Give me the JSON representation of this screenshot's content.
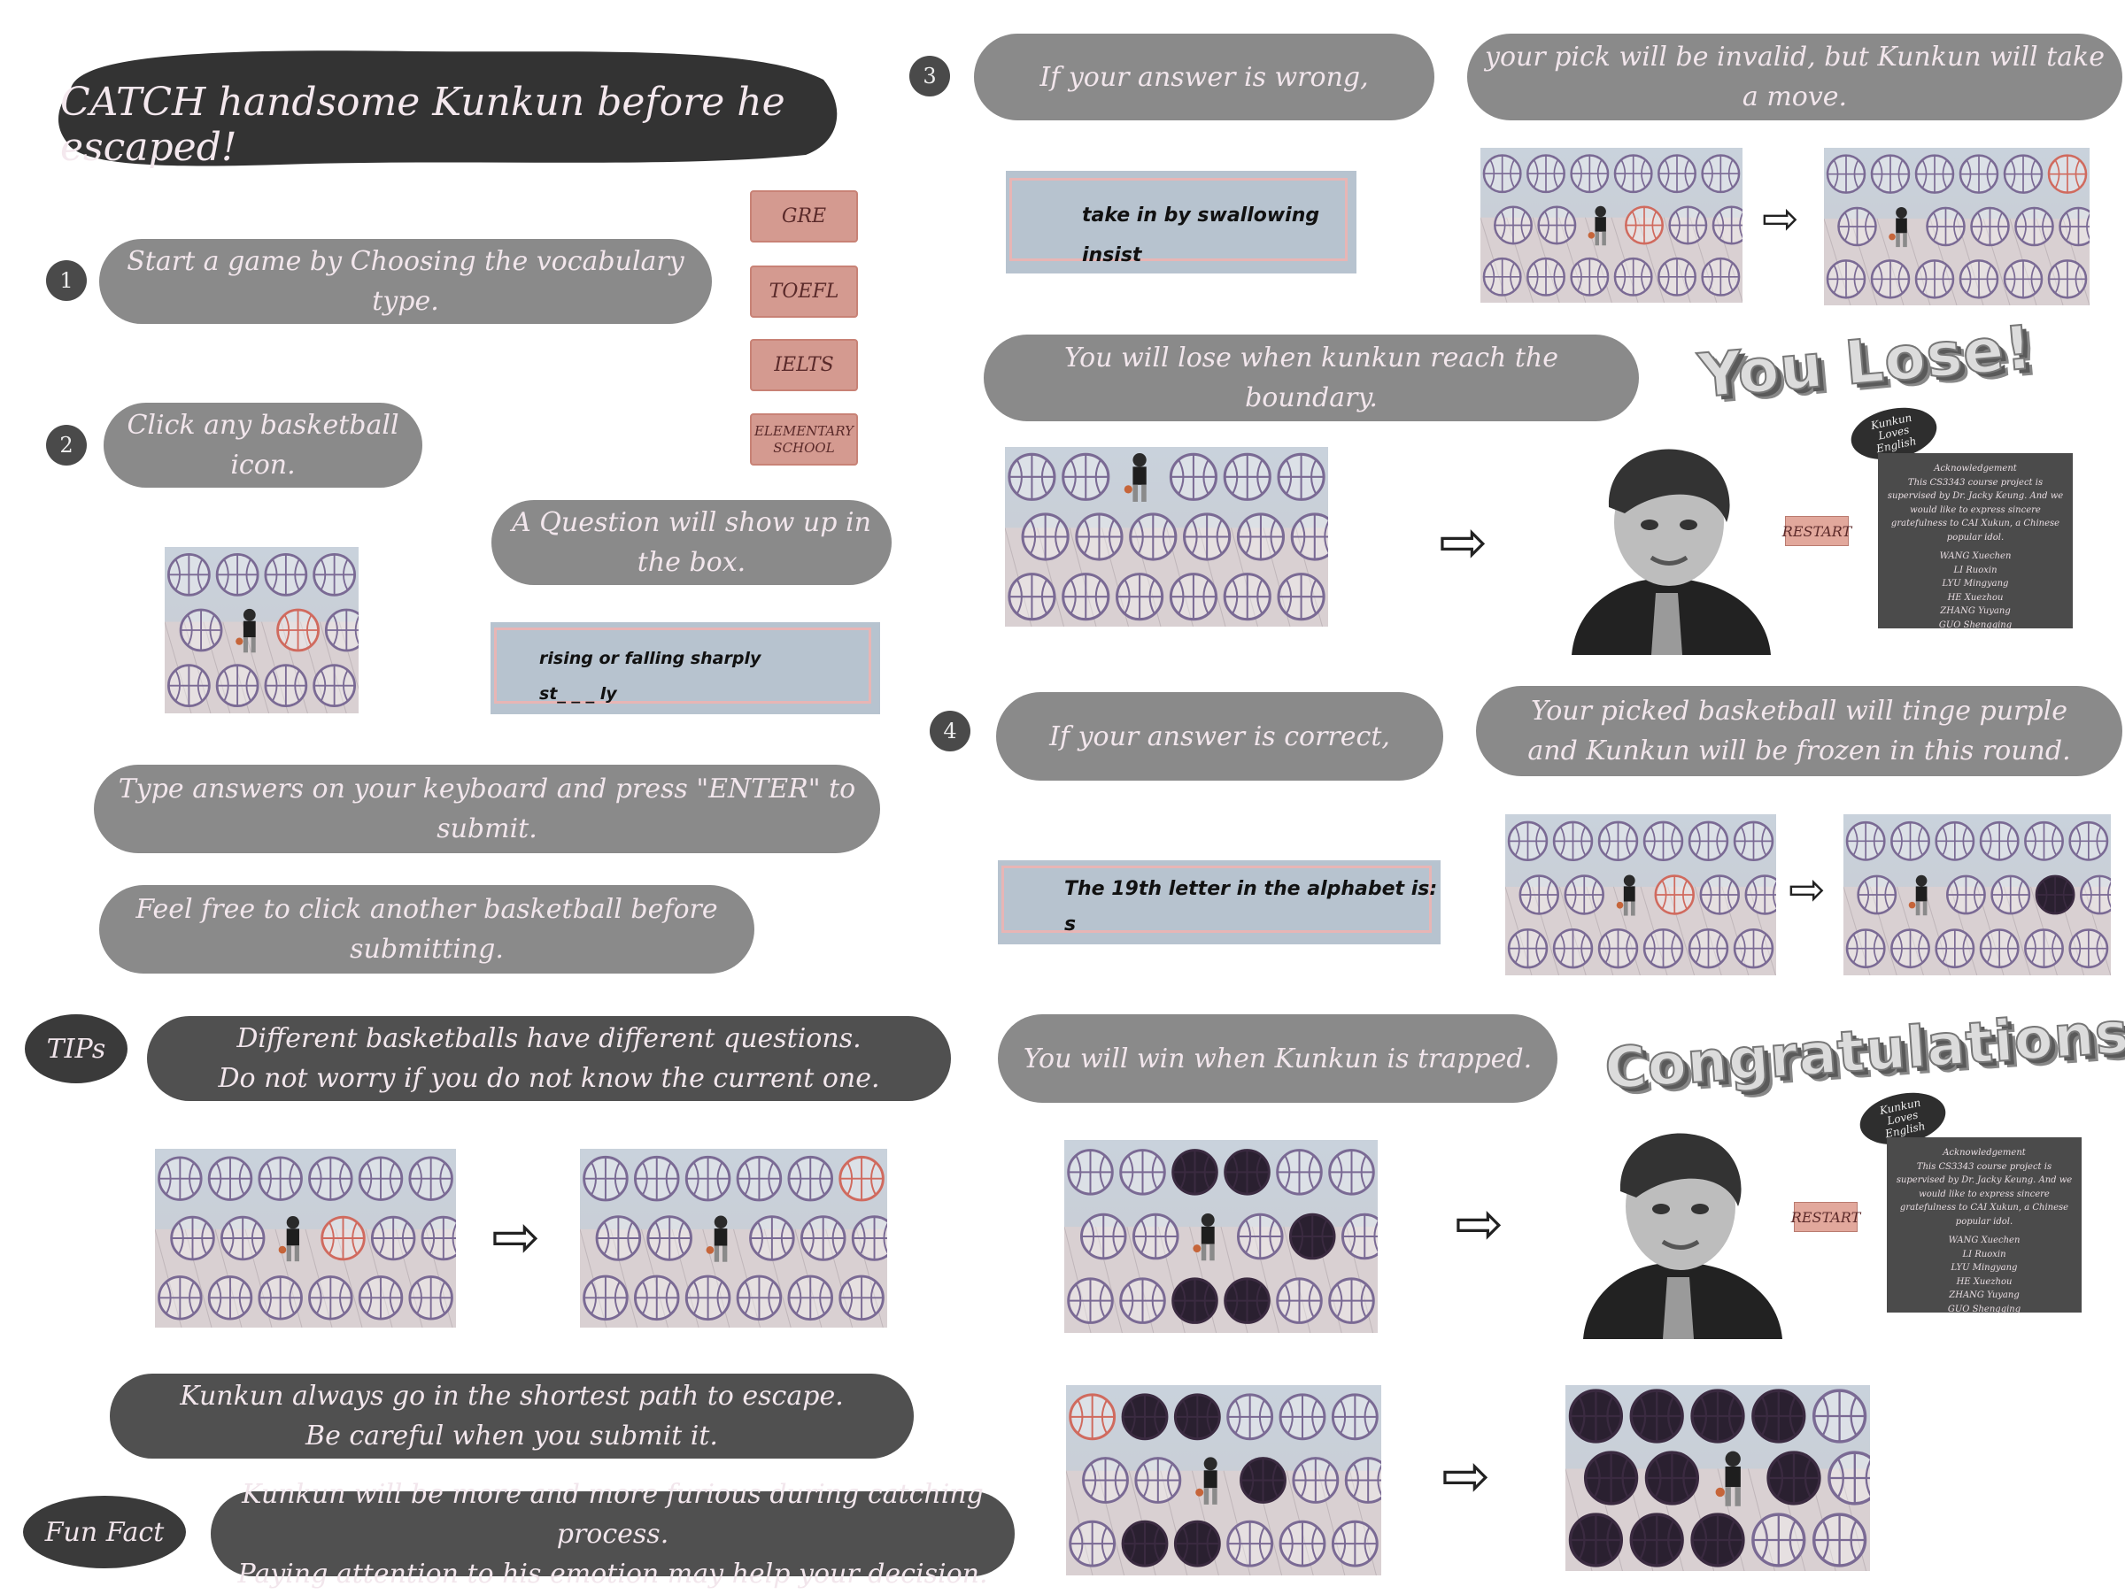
{
  "title": "CATCH handsome Kunkun before he escaped!",
  "steps": {
    "s1_num": "1",
    "s1_text": "Start a game by Choosing the vocabulary type.",
    "s2_num": "2",
    "s2_text": "Click any basketball icon.",
    "s2_question": "A Question will show up in the box.",
    "type_answers": "Type answers on your keyboard and press \"ENTER\" to submit.",
    "feel_free": "Feel free to click another basketball  before submitting.",
    "s3_num": "3",
    "s3_wrong": "If your answer is wrong,",
    "s3_invalid": "your pick will be invalid, but Kunkun will take a move.",
    "lose_text": "You will lose when kunkun reach the boundary.",
    "s4_num": "4",
    "s4_correct": "If your answer is correct,",
    "s4_tinge_l1": "Your picked basketball will tinge purple",
    "s4_tinge_l2": "and Kunkun will be frozen in this round.",
    "win_text": "You will win when Kunkun is trapped."
  },
  "vocab_buttons": [
    "GRE",
    "TOEFL",
    "IELTS",
    "ELEMENTARY SCHOOL"
  ],
  "question_boxes": {
    "q1_line1": "rising or falling sharply",
    "q1_line2": "st_ _ _ ly",
    "q2_line1": "take in by swallowing",
    "q2_line2": "insist",
    "q3_line1": "The 19th letter in the alphabet is:",
    "q3_line2": "s"
  },
  "tips": {
    "label": "TIPs",
    "l1": "Different basketballs have different questions.",
    "l2": "Do not worry if you do not know the current one.",
    "l3": "Kunkun always go in the shortest path to escape.",
    "l4": "Be careful when you submit it."
  },
  "funfact": {
    "label": "Fun Fact",
    "l1": "Kunkun will be more and more furious during catching process.",
    "l2": "Paying attention to his emotion may help your decision."
  },
  "endings": {
    "lose": "You Lose!",
    "win": "Congratulations!",
    "restart": "RESTART",
    "logo_l1": "Kunkun",
    "logo_l2": "Loves",
    "logo_l3": "English",
    "ack_title": "Acknowledgement",
    "ack_body": "This CS3343 course project is supervised by Dr. Jacky Keung. And we would like to express sincere gratefulness to CAI Xukun, a Chinese popular idol.",
    "ack_names": [
      "WANG Xuechen",
      "LI Ruoxin",
      "LYU Mingyang",
      "HE Xuezhou",
      "ZHANG Yuyang",
      "GUO Shengqing"
    ]
  },
  "colors": {
    "pill_gray": "#8a8a8a",
    "pill_dark": "#505050",
    "ball_purple": "#7a6a94",
    "ball_red": "#d06a5e",
    "ball_dark": "#2a2030",
    "button_pink": "#d49a90"
  }
}
